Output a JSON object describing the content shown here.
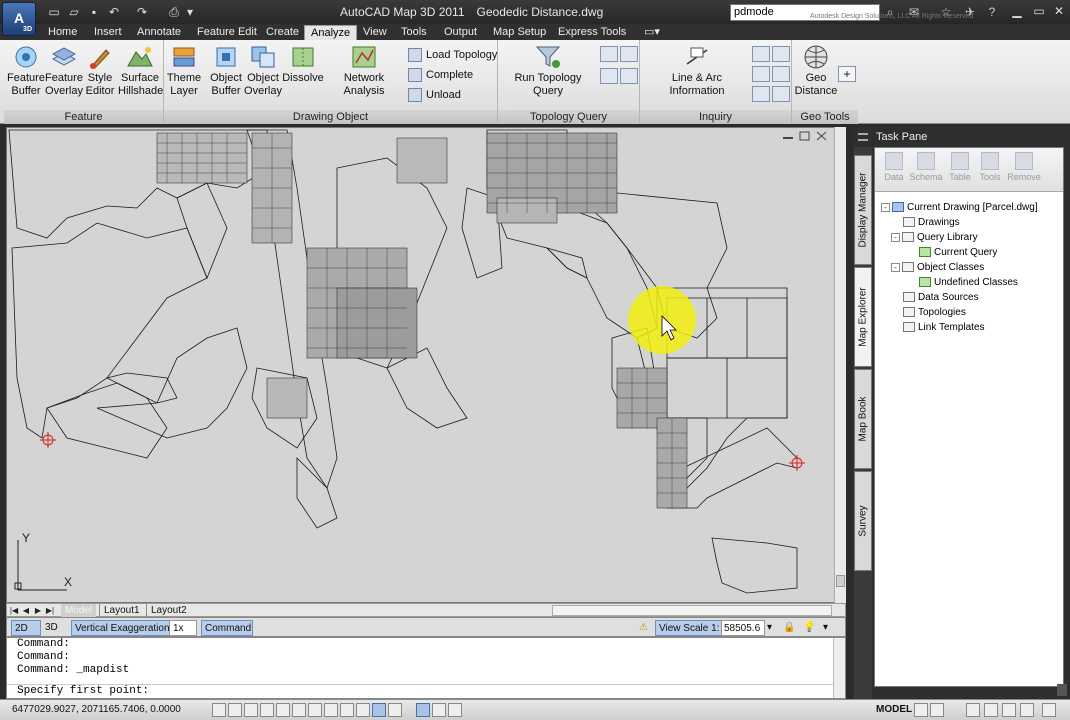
{
  "window": {
    "title": "AutoCAD Map 3D 2011",
    "document": "Geodedic Distance.dwg",
    "search_value": "pdmode",
    "copyright": "Autodesk Design Solutions, LLC All Rights Reserved",
    "app_badge": "3D"
  },
  "tabs": [
    "Home",
    "Insert",
    "Annotate",
    "Feature Edit",
    "Create",
    "Analyze",
    "View",
    "Tools",
    "Output",
    "Map Setup",
    "Express Tools"
  ],
  "active_tab": "Analyze",
  "ribbon": {
    "feature": {
      "title": "Feature",
      "buttons": [
        {
          "l1": "Feature",
          "l2": "Buffer"
        },
        {
          "l1": "Feature",
          "l2": "Overlay"
        },
        {
          "l1": "Style",
          "l2": "Editor"
        },
        {
          "l1": "Surface",
          "l2": "Hillshade"
        }
      ]
    },
    "drawing_object": {
      "title": "Drawing Object",
      "buttons": [
        {
          "l1": "Theme",
          "l2": "Layer"
        },
        {
          "l1": "Object",
          "l2": "Buffer"
        },
        {
          "l1": "Object",
          "l2": "Overlay"
        },
        {
          "l1": "Dissolve",
          "l2": ""
        },
        {
          "l1": "Network Analysis",
          "l2": ""
        }
      ],
      "small": [
        "Load Topology",
        "Complete",
        "Unload"
      ]
    },
    "topology_query": {
      "title": "Topology Query",
      "button": "Run Topology Query"
    },
    "inquiry": {
      "title": "Inquiry",
      "button": "Line & Arc Information"
    },
    "geo_tools": {
      "title": "Geo Tools",
      "l1": "Geo",
      "l2": "Distance"
    }
  },
  "layout_tabs": [
    "Model",
    "Layout1",
    "Layout2"
  ],
  "ucs": {
    "y": "Y",
    "x": "X"
  },
  "drawing_status": {
    "mode_2d": "2D",
    "mode_3d": "3D",
    "vertical_exaggeration": "Vertical Exaggeration:",
    "ve_value": "1x",
    "command": "Command",
    "view_scale_label": "View Scale",
    "view_scale_value": "1:",
    "scale_number": "58505.6"
  },
  "command_lines": [
    "Command:",
    "Command:",
    "Command:  _mapdist"
  ],
  "command_prompt": "Specify first point:",
  "status": {
    "coords": "6477029.9027, 2071165.7406, 0.0000",
    "model": "MODEL"
  },
  "task_pane": {
    "title": "Task Pane",
    "side_tabs": [
      "Display Manager",
      "Map Explorer",
      "Map Book",
      "Survey"
    ],
    "toolbar": [
      "Data",
      "Schema",
      "Table",
      "Tools",
      "Remove"
    ],
    "tree": [
      {
        "label": "Current Drawing [Parcel.dwg]",
        "level": 0,
        "box": "-",
        "kind": "blue"
      },
      {
        "label": "Drawings",
        "level": 1,
        "box": "",
        "kind": "plain"
      },
      {
        "label": "Query Library",
        "level": 1,
        "box": "-",
        "kind": "plain"
      },
      {
        "label": "Current Query",
        "level": 2,
        "box": "",
        "kind": "green"
      },
      {
        "label": "Object Classes",
        "level": 1,
        "box": "-",
        "kind": "plain"
      },
      {
        "label": "Undefined Classes",
        "level": 2,
        "box": "",
        "kind": "green"
      },
      {
        "label": "Data Sources",
        "level": 1,
        "box": "",
        "kind": "plain"
      },
      {
        "label": "Topologies",
        "level": 1,
        "box": "",
        "kind": "plain"
      },
      {
        "label": "Link Templates",
        "level": 1,
        "box": "",
        "kind": "plain"
      }
    ]
  },
  "colors": {
    "accent": "#4b70a8",
    "marker": "#d42020",
    "highlight": "#f2ee10"
  }
}
